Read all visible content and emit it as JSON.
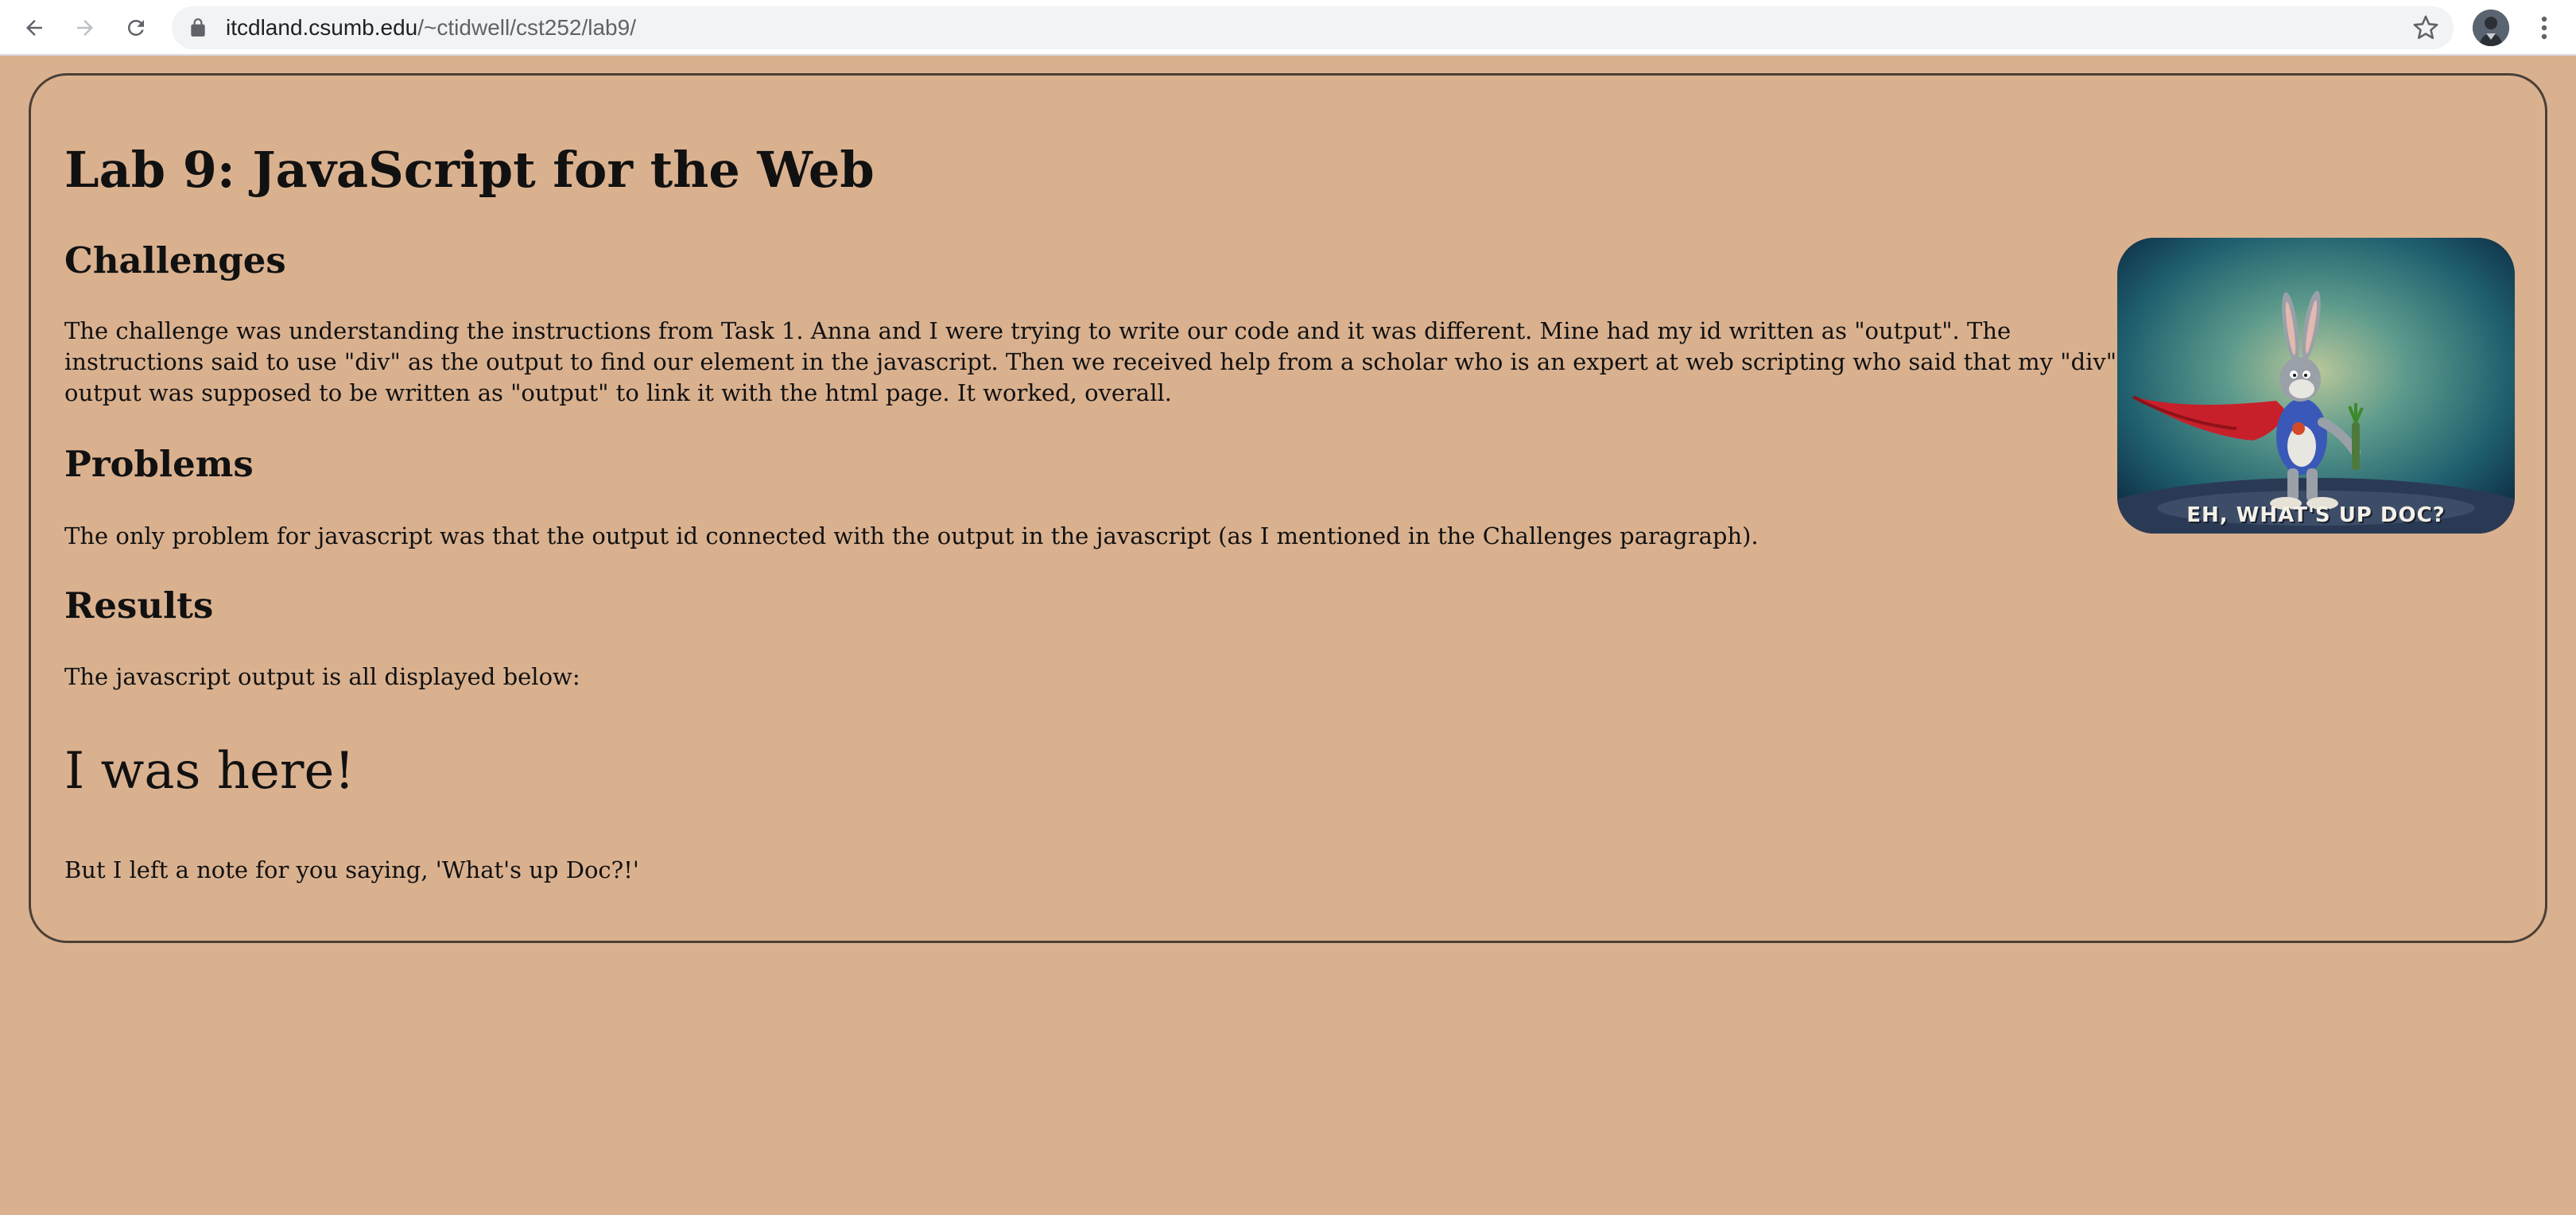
{
  "browser": {
    "url_host": "itcdland.csumb.edu",
    "url_path": "/~ctidwell/cst252/lab9/",
    "icons": {
      "back": "arrow-left-icon",
      "forward": "arrow-right-icon",
      "reload": "reload-icon",
      "lock": "lock-icon",
      "bookmark": "star-icon",
      "menu": "kebab-menu-icon"
    }
  },
  "page": {
    "title": "Lab 9: JavaScript for the Web",
    "challenges_heading": "Challenges",
    "challenges_text": "The challenge was understanding the instructions from Task 1. Anna and I were trying to write our code and it was different. Mine had my id written as \"output\". The instructions said to use \"div\" as the output to find our element in the javascript. Then we received help from a scholar who is an expert at web scripting who said that my \"div\" output was supposed to be written as \"output\" to link it with the html page. It worked, overall.",
    "problems_heading": "Problems",
    "problems_text": "The only problem for javascript was that the output id connected with the output in the javascript (as I mentioned in the Challenges paragraph).",
    "results_heading": "Results",
    "results_text": "The javascript output is all displayed below:",
    "output_text": "I was here!",
    "note_text": "But I left a note for you saying, 'What's up Doc?!'",
    "gif_caption": "EH, WHAT'S UP DOC?"
  },
  "colors": {
    "page_background": "#dab18f",
    "border": "#4a4038",
    "text": "#111111"
  }
}
